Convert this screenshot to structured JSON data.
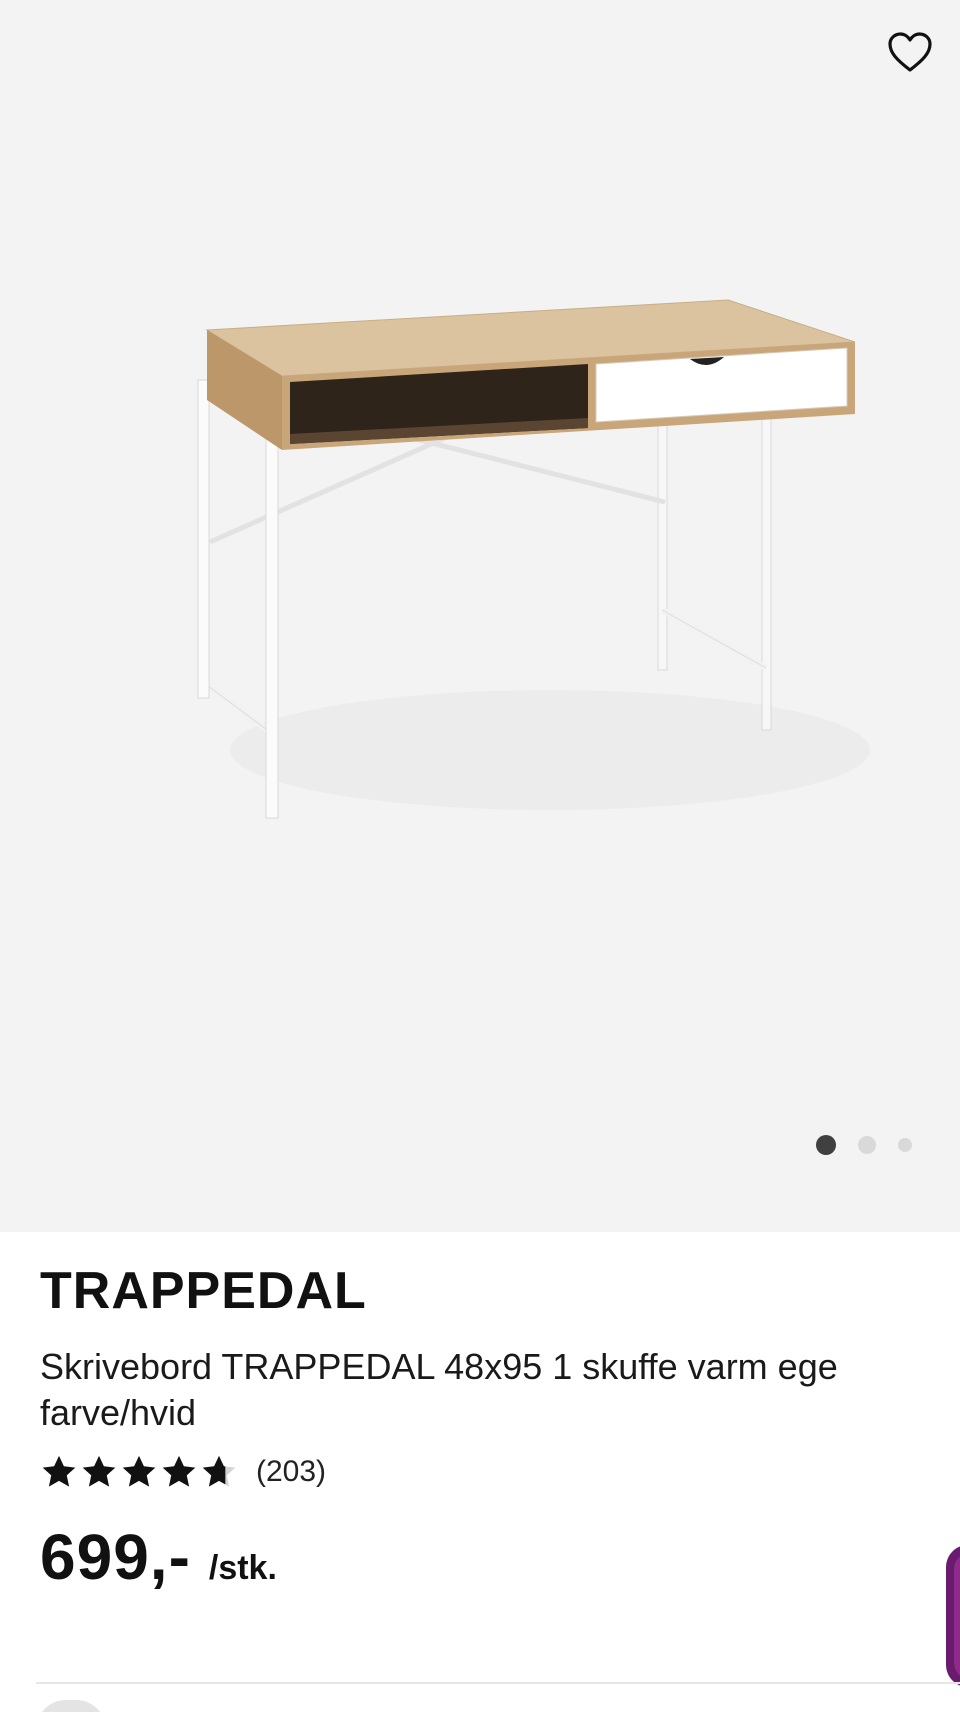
{
  "product": {
    "brand": "TRAPPEDAL",
    "description": "Skrivebord TRAPPEDAL 48x95 1 skuffe varm ege farve/hvid",
    "rating": {
      "stars_filled": 4.5,
      "stars_total": 5,
      "review_count": "(203)"
    },
    "price": "699,-",
    "unit": "/stk."
  },
  "gallery": {
    "image_count": 3,
    "active_index": 0
  },
  "icons": {
    "favorite": "heart-outline-icon",
    "star": "star-icon"
  },
  "colors": {
    "gallery_bg": "#f3f3f4",
    "text": "#111111",
    "dot_active": "#404040",
    "dot_inactive": "#d9d9d9",
    "accent_tab": "#6a1b6e"
  }
}
